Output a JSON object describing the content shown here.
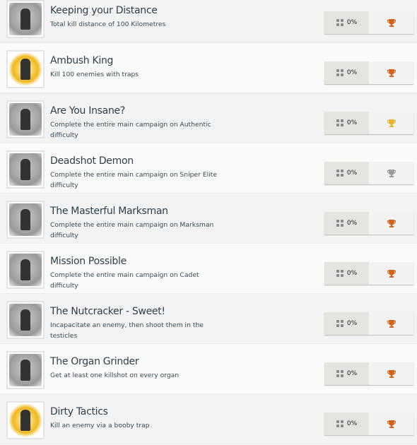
{
  "achievements": [
    {
      "title": "Keeping your Distance",
      "description": "Total kill distance of 100 Kilometres",
      "progress": "0%",
      "trophy": "bronze",
      "trophy_color": "#d4611c",
      "art": "100km-icon"
    },
    {
      "title": "Ambush King",
      "description": "Kill 100 enemies with traps",
      "progress": "0%",
      "trophy": "bronze",
      "trophy_color": "#d4611c",
      "art": "ambush-icon"
    },
    {
      "title": "Are You Insane?",
      "description": "Complete the entire main campaign on Authentic difficulty",
      "progress": "0%",
      "trophy": "gold",
      "trophy_color": "#e6b531",
      "art": "soldier-icon"
    },
    {
      "title": "Deadshot Demon",
      "description": "Complete the entire main campaign on Sniper Elite difficulty",
      "progress": "0%",
      "trophy": "silver",
      "trophy_color": "#9a9a9a",
      "art": "demon-icon"
    },
    {
      "title": "The Masterful Marksman",
      "description": "Complete the entire main campaign on Marksman difficulty",
      "progress": "0%",
      "trophy": "bronze",
      "trophy_color": "#d4611c",
      "art": "marksman-icon"
    },
    {
      "title": "Mission Possible",
      "description": "Complete the entire main campaign on Cadet difficulty",
      "progress": "0%",
      "trophy": "bronze",
      "trophy_color": "#d4611c",
      "art": "agent-icon"
    },
    {
      "title": "The Nutcracker - Sweet!",
      "description": "Incapacitate an enemy, then shoot them in the testicles",
      "progress": "0%",
      "trophy": "bronze",
      "trophy_color": "#d4611c",
      "art": "nutcracker-icon"
    },
    {
      "title": "The Organ Grinder",
      "description": "Get at least one killshot on every organ",
      "progress": "0%",
      "trophy": "bronze",
      "trophy_color": "#d4611c",
      "art": "skeleton-icon"
    },
    {
      "title": "Dirty Tactics",
      "description": "Kill an enemy via a booby trap",
      "progress": "0%",
      "trophy": "bronze",
      "trophy_color": "#d4611c",
      "art": "explosion-icon"
    }
  ]
}
